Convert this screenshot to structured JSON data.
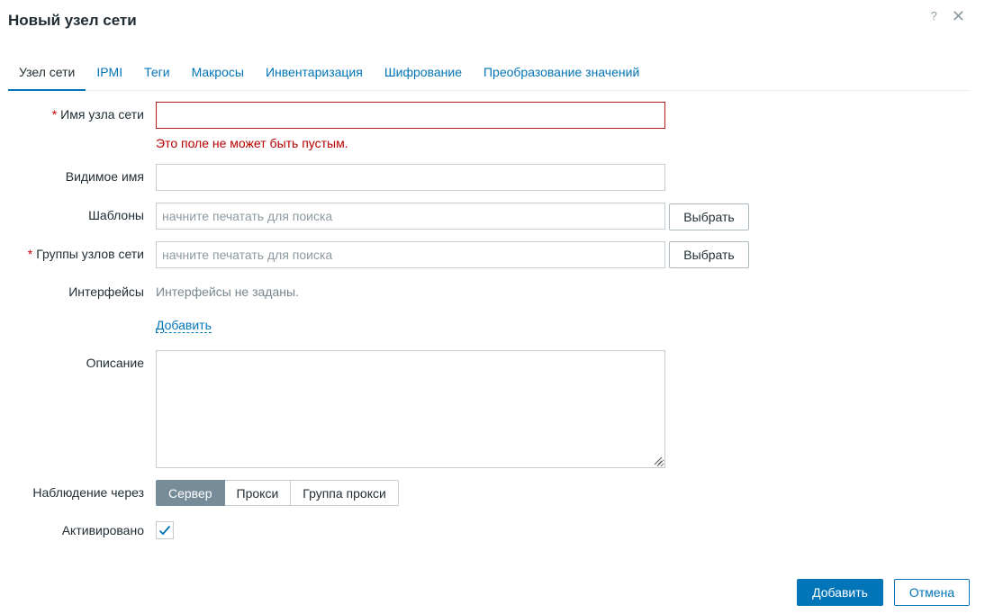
{
  "dialog": {
    "title": "Новый узел сети",
    "help_glyph": "?",
    "close_glyph": "✕"
  },
  "tabs": [
    {
      "label": "Узел сети",
      "active": true
    },
    {
      "label": "IPMI"
    },
    {
      "label": "Теги"
    },
    {
      "label": "Макросы"
    },
    {
      "label": "Инвентаризация"
    },
    {
      "label": "Шифрование"
    },
    {
      "label": "Преобразование значений"
    }
  ],
  "form": {
    "host_name": {
      "label": "Имя узла сети",
      "required": true,
      "value": "",
      "error": "Это поле не может быть пустым."
    },
    "visible_name": {
      "label": "Видимое имя",
      "value": ""
    },
    "templates": {
      "label": "Шаблоны",
      "placeholder": "начните печатать для поиска",
      "button": "Выбрать"
    },
    "host_groups": {
      "label": "Группы узлов сети",
      "required": true,
      "placeholder": "начните печатать для поиска",
      "button": "Выбрать"
    },
    "interfaces": {
      "label": "Интерфейсы",
      "empty_text": "Интерфейсы не заданы.",
      "add_link": "Добавить"
    },
    "description": {
      "label": "Описание",
      "value": ""
    },
    "monitored_by": {
      "label": "Наблюдение через",
      "options": [
        "Сервер",
        "Прокси",
        "Группа прокси"
      ],
      "selected": "Сервер"
    },
    "enabled": {
      "label": "Активировано",
      "checked": true
    }
  },
  "footer": {
    "add_button": "Добавить",
    "cancel_button": "Отмена"
  },
  "colors": {
    "accent": "#0275b8",
    "error": "#b80000",
    "segment_active": "#768d99"
  }
}
